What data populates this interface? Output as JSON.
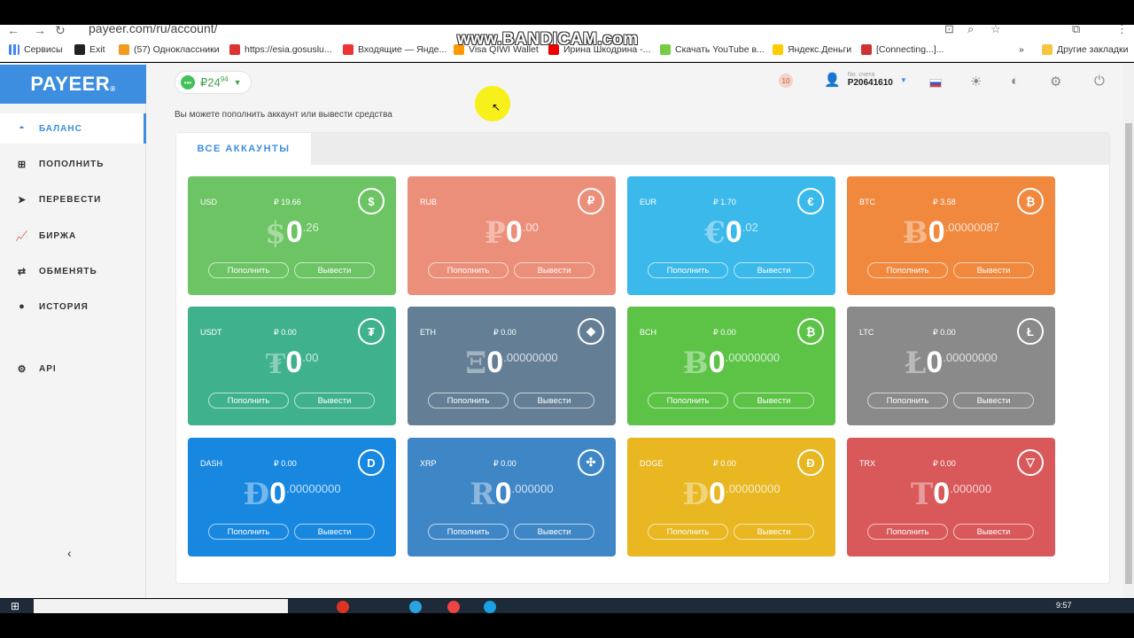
{
  "browser": {
    "url": "payeer.com/ru/account/",
    "bookmarks": [
      "Сервисы",
      "Exit",
      "(57) Одноклассники",
      "https://esia.gosuslu...",
      "Входящие — Янде...",
      "Visa QIWI Wallet",
      "Ирина Шкодрина -...",
      "Скачать YouTube в...",
      "Яндекс.Деньги",
      "[Connecting...]...",
      "Другие закладки"
    ],
    "more": "»",
    "watermark": "www.BANDICAM.com"
  },
  "sidebar": {
    "logo": "PAYEER",
    "logo_mark": "®",
    "items": [
      {
        "label": "БАЛАНС",
        "icon": "wallet-icon"
      },
      {
        "label": "ПОПОЛНИТЬ",
        "icon": "plus-icon"
      },
      {
        "label": "ПЕРЕВЕСТИ",
        "icon": "send-icon"
      },
      {
        "label": "БИРЖА",
        "icon": "chart-icon"
      },
      {
        "label": "ОБМЕНЯТЬ",
        "icon": "exchange-icon"
      },
      {
        "label": "ИСТОРИЯ",
        "icon": "clock-icon"
      },
      {
        "label": "API",
        "icon": "gears-icon"
      }
    ],
    "collapse": "‹"
  },
  "header": {
    "balance_int": "₽24",
    "balance_frac": "94",
    "notifications": "10",
    "account_label": "No. счета",
    "account_number": "P20641610",
    "hint": "Вы можете пополнить аккаунт или вывести средства"
  },
  "tabs": {
    "all_accounts": "ВСЕ АККАУНТЫ"
  },
  "card_actions": {
    "deposit": "Пополнить",
    "withdraw": "Вывести"
  },
  "accounts": [
    {
      "code": "USD",
      "rate": "₽ 19.66",
      "symbol": "$",
      "int": "0",
      "frac": ".26",
      "icon": "$",
      "color": "#6cc464"
    },
    {
      "code": "RUB",
      "rate": "",
      "symbol": "₽",
      "int": "0",
      "frac": ".00",
      "icon": "₽",
      "color": "#ec8f7a"
    },
    {
      "code": "EUR",
      "rate": "₽ 1.70",
      "symbol": "€",
      "int": "0",
      "frac": ".02",
      "icon": "€",
      "color": "#3ab9ea"
    },
    {
      "code": "BTC",
      "rate": "₽ 3.58",
      "symbol": "Ƀ",
      "int": "0",
      "frac": ".00000087",
      "icon": "₿",
      "color": "#f0883e"
    },
    {
      "code": "USDT",
      "rate": "₽ 0.00",
      "symbol": "₮",
      "int": "0",
      "frac": ".00",
      "icon": "₮",
      "color": "#3fb28d"
    },
    {
      "code": "ETH",
      "rate": "₽ 0.00",
      "symbol": "Ξ",
      "int": "0",
      "frac": ".00000000",
      "icon": "◆",
      "color": "#647f95"
    },
    {
      "code": "BCH",
      "rate": "₽ 0.00",
      "symbol": "Ƀ",
      "int": "0",
      "frac": ".00000000",
      "icon": "₿",
      "color": "#5cc347"
    },
    {
      "code": "LTC",
      "rate": "₽ 0.00",
      "symbol": "Ł",
      "int": "0",
      "frac": ".00000000",
      "icon": "Ł",
      "color": "#8a8a8a"
    },
    {
      "code": "DASH",
      "rate": "₽ 0.00",
      "symbol": "Đ",
      "int": "0",
      "frac": ".00000000",
      "icon": "D",
      "color": "#1787e0"
    },
    {
      "code": "XRP",
      "rate": "₽ 0.00",
      "symbol": "R",
      "int": "0",
      "frac": ".000000",
      "icon": "✣",
      "color": "#3f86c6"
    },
    {
      "code": "DOGE",
      "rate": "₽ 0.00",
      "symbol": "Đ",
      "int": "0",
      "frac": ".00000000",
      "icon": "Đ",
      "color": "#e8b722"
    },
    {
      "code": "TRX",
      "rate": "₽ 0.00",
      "symbol": "T",
      "int": "0",
      "frac": ".000000",
      "icon": "▽",
      "color": "#d9585a"
    }
  ],
  "taskbar": {
    "time": "9:57"
  }
}
